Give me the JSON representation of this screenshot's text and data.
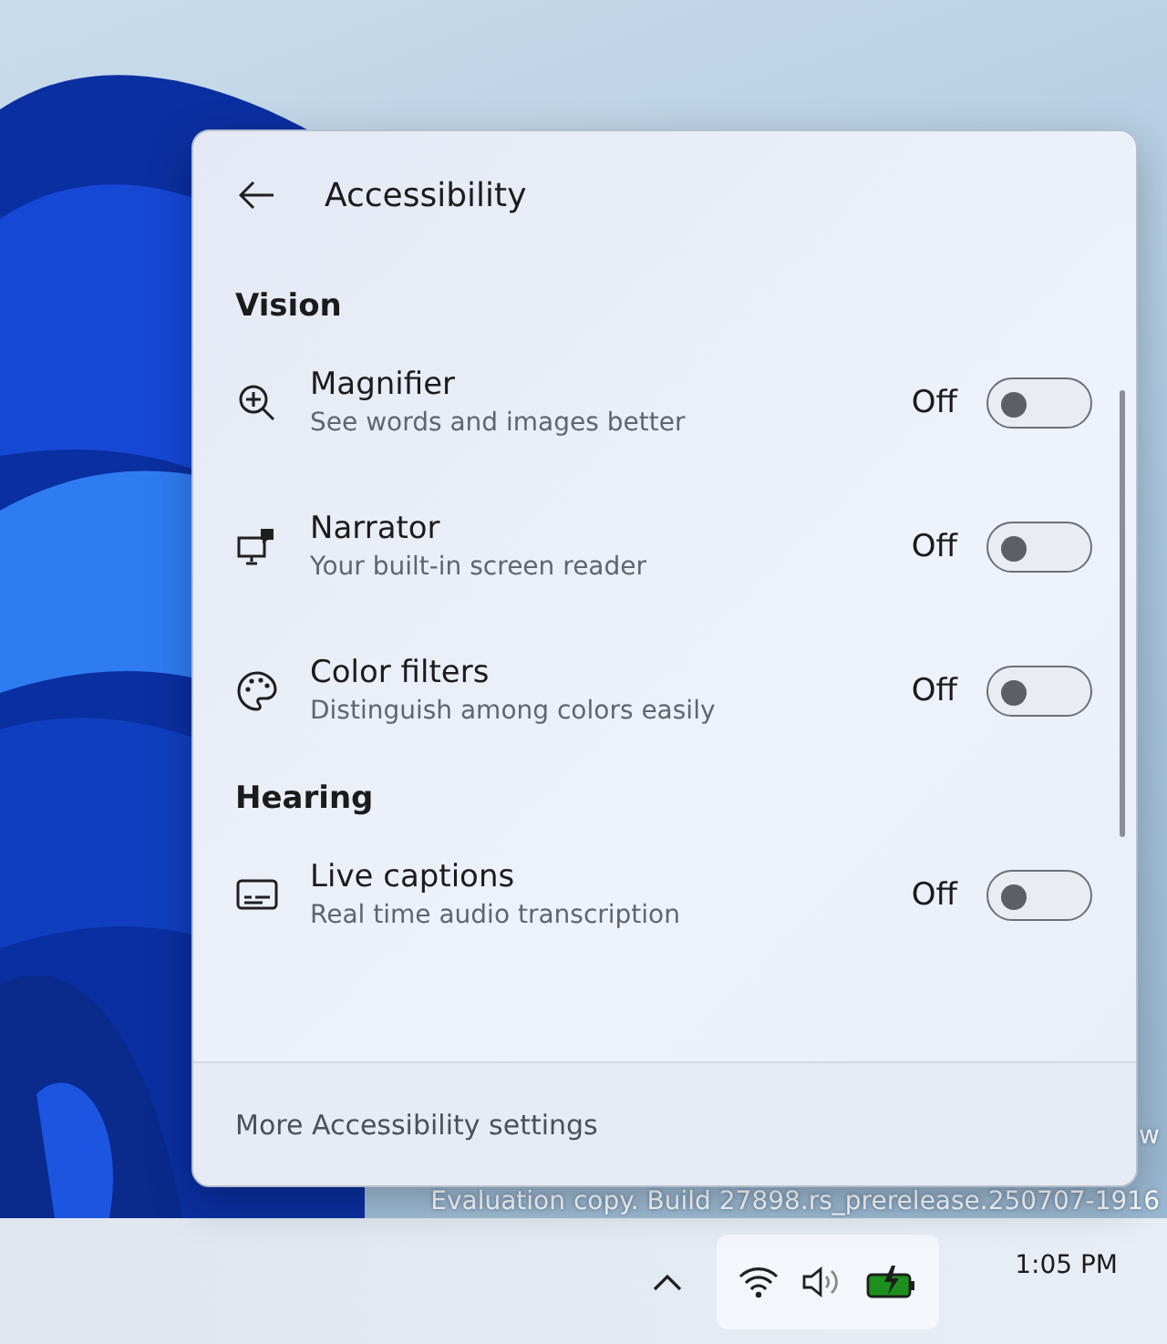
{
  "panel": {
    "title": "Accessibility",
    "sections": [
      {
        "heading": "Vision",
        "items": [
          {
            "kind": "magnifier",
            "title": "Magnifier",
            "subtitle": "See words and images better",
            "state_label": "Off",
            "on": false
          },
          {
            "kind": "narrator",
            "title": "Narrator",
            "subtitle": "Your built-in screen reader",
            "state_label": "Off",
            "on": false
          },
          {
            "kind": "palette",
            "title": "Color filters",
            "subtitle": "Distinguish among colors easily",
            "state_label": "Off",
            "on": false
          }
        ]
      },
      {
        "heading": "Hearing",
        "items": [
          {
            "kind": "captions",
            "title": "Live captions",
            "subtitle": "Real time audio transcription",
            "state_label": "Off",
            "on": false
          }
        ]
      }
    ],
    "footer_link": "More Accessibility settings"
  },
  "desktop": {
    "watermark_lines": [
      "w",
      "Evaluation copy. Build 27898.rs_prerelease.250707-1916"
    ]
  },
  "taskbar": {
    "clock": "1:05 PM"
  }
}
